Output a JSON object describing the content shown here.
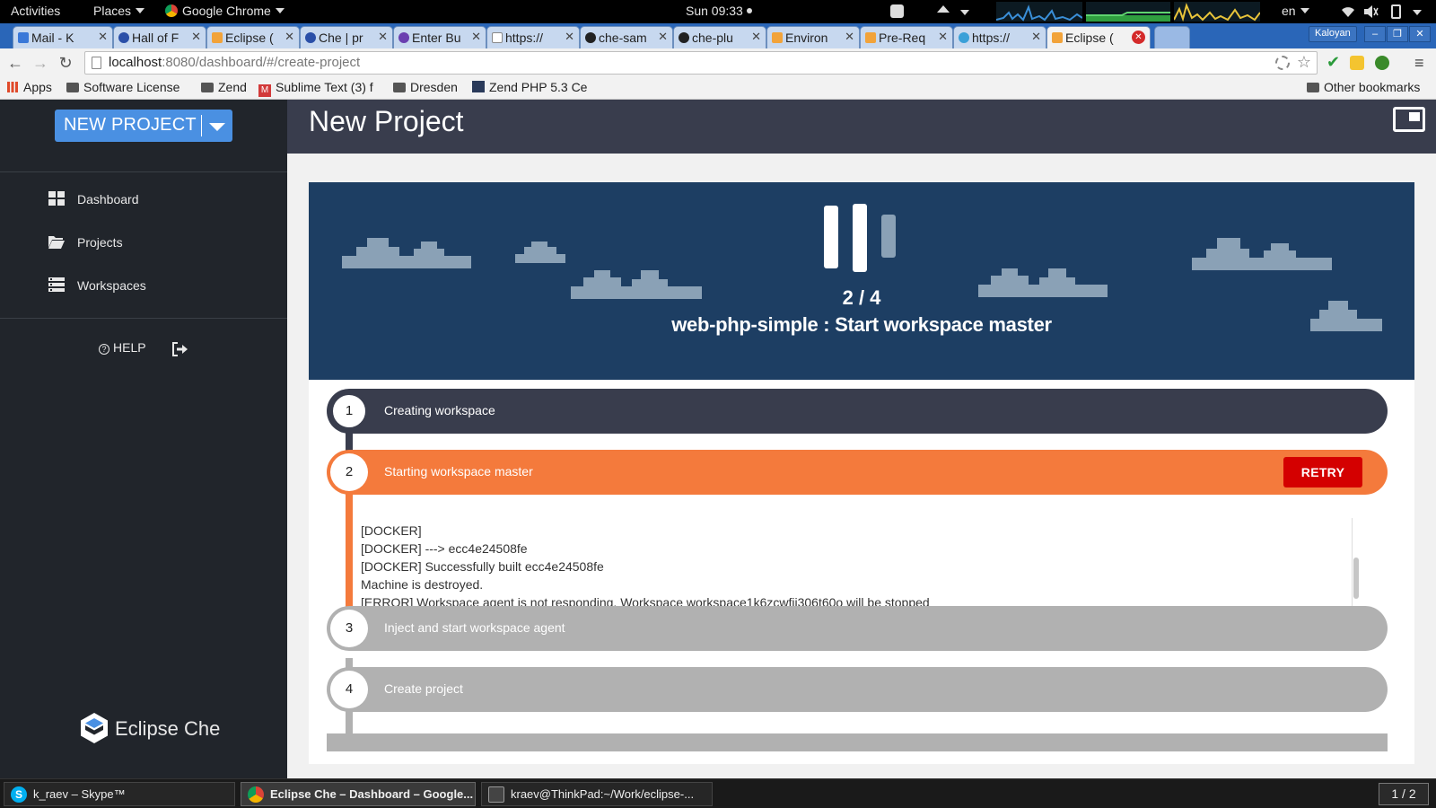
{
  "topbar": {
    "activities": "Activities",
    "places": "Places",
    "app_menu": "Google Chrome",
    "clock": "Sun 09:33",
    "lang": "en"
  },
  "tabs": [
    {
      "label": "Mail - K",
      "color": "#3a78d8"
    },
    {
      "label": "Hall of F",
      "color": "#2a4fa8"
    },
    {
      "label": "Eclipse (",
      "color": "#f2a33a"
    },
    {
      "label": "Che | pr",
      "color": "#2a4fa8"
    },
    {
      "label": "Enter Bu",
      "color": "#6a3fb0"
    },
    {
      "label": "https://",
      "color": "#9a9a9a"
    },
    {
      "label": "che-sam",
      "color": "#222222"
    },
    {
      "label": "che-plu",
      "color": "#222222"
    },
    {
      "label": "Environ",
      "color": "#f2a33a"
    },
    {
      "label": "Pre-Req",
      "color": "#f2a33a"
    },
    {
      "label": "https://",
      "color": "#3aa0d8"
    },
    {
      "label": "Eclipse (",
      "color": "#f2a33a"
    }
  ],
  "profile_name": "Kaloyan",
  "omnibox": {
    "host": "localhost",
    "path": ":8080/dashboard/#/create-project"
  },
  "bookmarks": {
    "apps": "Apps",
    "items": [
      "Software License",
      "Zend",
      "Sublime Text (3) f",
      "Dresden",
      "Zend PHP 5.3 Ce"
    ],
    "other": "Other bookmarks"
  },
  "sidebar": {
    "new_project": "NEW PROJECT",
    "nav": [
      {
        "label": "Dashboard"
      },
      {
        "label": "Projects"
      },
      {
        "label": "Workspaces"
      }
    ],
    "help": "HELP",
    "logo_text": "Eclipse Che"
  },
  "main": {
    "title": "New Project",
    "progress": {
      "current": 2,
      "total": 4
    },
    "step_count": "2 / 4",
    "step_title": "web-php-simple : Start workspace master",
    "steps": [
      {
        "num": "1",
        "label": "Creating workspace",
        "state": "done"
      },
      {
        "num": "2",
        "label": "Starting workspace master",
        "state": "active"
      },
      {
        "num": "3",
        "label": "Inject and start workspace agent",
        "state": "pending"
      },
      {
        "num": "4",
        "label": "Create project",
        "state": "pending"
      }
    ],
    "retry": "RETRY",
    "log": [
      "[DOCKER]",
      "[DOCKER] ---> ecc4e24508fe",
      "[DOCKER] Successfully built ecc4e24508fe",
      "Machine is destroyed.",
      "[ERROR] Workspace agent is not responding. Workspace workspace1k6zcwfij306t60o will be stopped"
    ]
  },
  "taskbar": {
    "items": [
      {
        "label": "k_raev – Skype™"
      },
      {
        "label": "Eclipse Che – Dashboard – Google..."
      },
      {
        "label": "kraev@ThinkPad:~/Work/eclipse-..."
      }
    ],
    "workspace": "1 / 2"
  },
  "colors": {
    "sidebar": "#21252b",
    "header": "#393d4d",
    "banner": "#1d3e63",
    "accent_blue": "#4a90e2",
    "active_step": "#f47a3c",
    "pending_step": "#b1b1b1",
    "retry": "#d40000"
  }
}
